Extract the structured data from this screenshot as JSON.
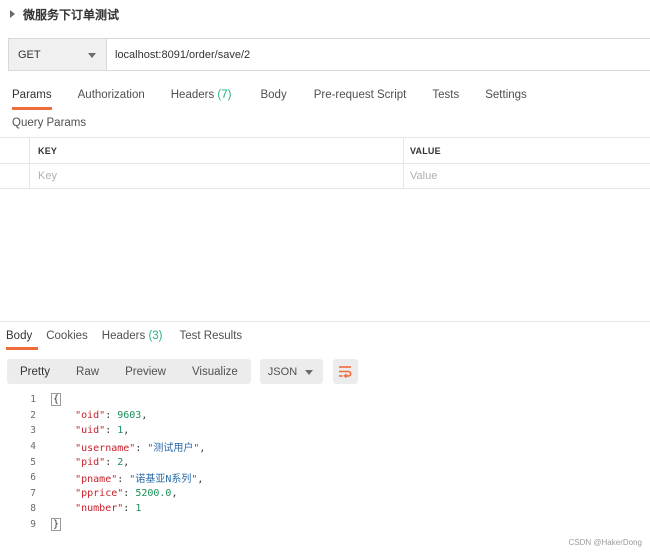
{
  "request": {
    "name": "微服务下订单测试",
    "method": "GET",
    "url": "localhost:8091/order/save/2"
  },
  "request_tabs": {
    "params": "Params",
    "authorization": "Authorization",
    "headers": "Headers",
    "headers_count": "(7)",
    "body": "Body",
    "prerequest": "Pre-request Script",
    "tests": "Tests",
    "settings": "Settings"
  },
  "query_params": {
    "title": "Query Params",
    "key_header": "KEY",
    "value_header": "VALUE",
    "key_placeholder": "Key",
    "value_placeholder": "Value"
  },
  "response_tabs": {
    "body": "Body",
    "cookies": "Cookies",
    "headers": "Headers",
    "headers_count": "(3)",
    "test_results": "Test Results"
  },
  "view_modes": {
    "pretty": "Pretty",
    "raw": "Raw",
    "preview": "Preview",
    "visualize": "Visualize"
  },
  "format": "JSON",
  "wrap_icon": "wrap-lines-icon",
  "code_lines": [
    {
      "no": "1",
      "open": "{"
    },
    {
      "no": "2",
      "key": "\"oid\"",
      "sep": ": ",
      "val": "9603",
      "val_type": "n",
      "comma": ","
    },
    {
      "no": "3",
      "key": "\"uid\"",
      "sep": ": ",
      "val": "1",
      "val_type": "n",
      "comma": ","
    },
    {
      "no": "4",
      "key": "\"username\"",
      "sep": ": ",
      "val": "\"测试用户\"",
      "val_type": "s",
      "comma": ","
    },
    {
      "no": "5",
      "key": "\"pid\"",
      "sep": ": ",
      "val": "2",
      "val_type": "n",
      "comma": ","
    },
    {
      "no": "6",
      "key": "\"pname\"",
      "sep": ": ",
      "val": "\"诺基亚N系列\"",
      "val_type": "s",
      "comma": ","
    },
    {
      "no": "7",
      "key": "\"pprice\"",
      "sep": ": ",
      "val": "5200.0",
      "val_type": "n",
      "comma": ","
    },
    {
      "no": "8",
      "key": "\"number\"",
      "sep": ": ",
      "val": "1",
      "val_type": "n",
      "comma": ""
    },
    {
      "no": "9",
      "close": "}"
    }
  ],
  "watermark": "CSDN @HakerDong",
  "colors": {
    "accent": "#f26b3a",
    "count": "#26b47f",
    "json_key": "#c8222b",
    "json_string": "#2b6ba8",
    "json_number": "#1a8f5a"
  }
}
